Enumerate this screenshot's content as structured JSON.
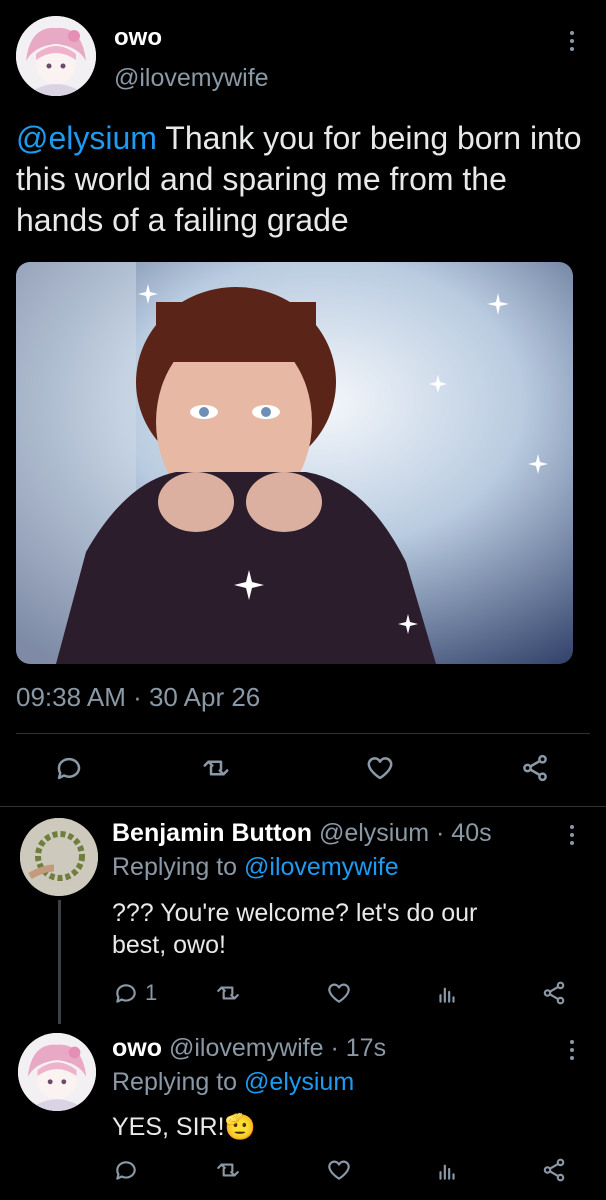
{
  "main_tweet": {
    "display_name": "owo",
    "handle": "@ilovemywife",
    "mention": "@elysium",
    "text": "Thank you for being born into this world and sparing me from the hands of a failing grade",
    "timestamp": "09:38 AM · 30 Apr 26"
  },
  "actions": {
    "reply_icon": "reply-icon",
    "retweet_icon": "retweet-icon",
    "like_icon": "heart-icon",
    "share_icon": "share-icon",
    "views_icon": "views-icon"
  },
  "replies": [
    {
      "display_name": "Benjamin Button",
      "handle": "@elysium",
      "age": "· 40s",
      "replying_prefix": "Replying to",
      "replying_to": "@ilovemywife",
      "text": "??? You're welcome? let's do our best, owo!",
      "reply_count": "1"
    },
    {
      "display_name": "owo",
      "handle": "@ilovemywife",
      "age": "· 17s",
      "replying_prefix": "Replying to",
      "replying_to": "@elysium",
      "text": "YES, SIR!",
      "emoji": "🫡"
    }
  ],
  "colors": {
    "background": "#000000",
    "accent": "#1d9bf0",
    "muted": "#8b98a5",
    "divider": "#2f3336"
  }
}
